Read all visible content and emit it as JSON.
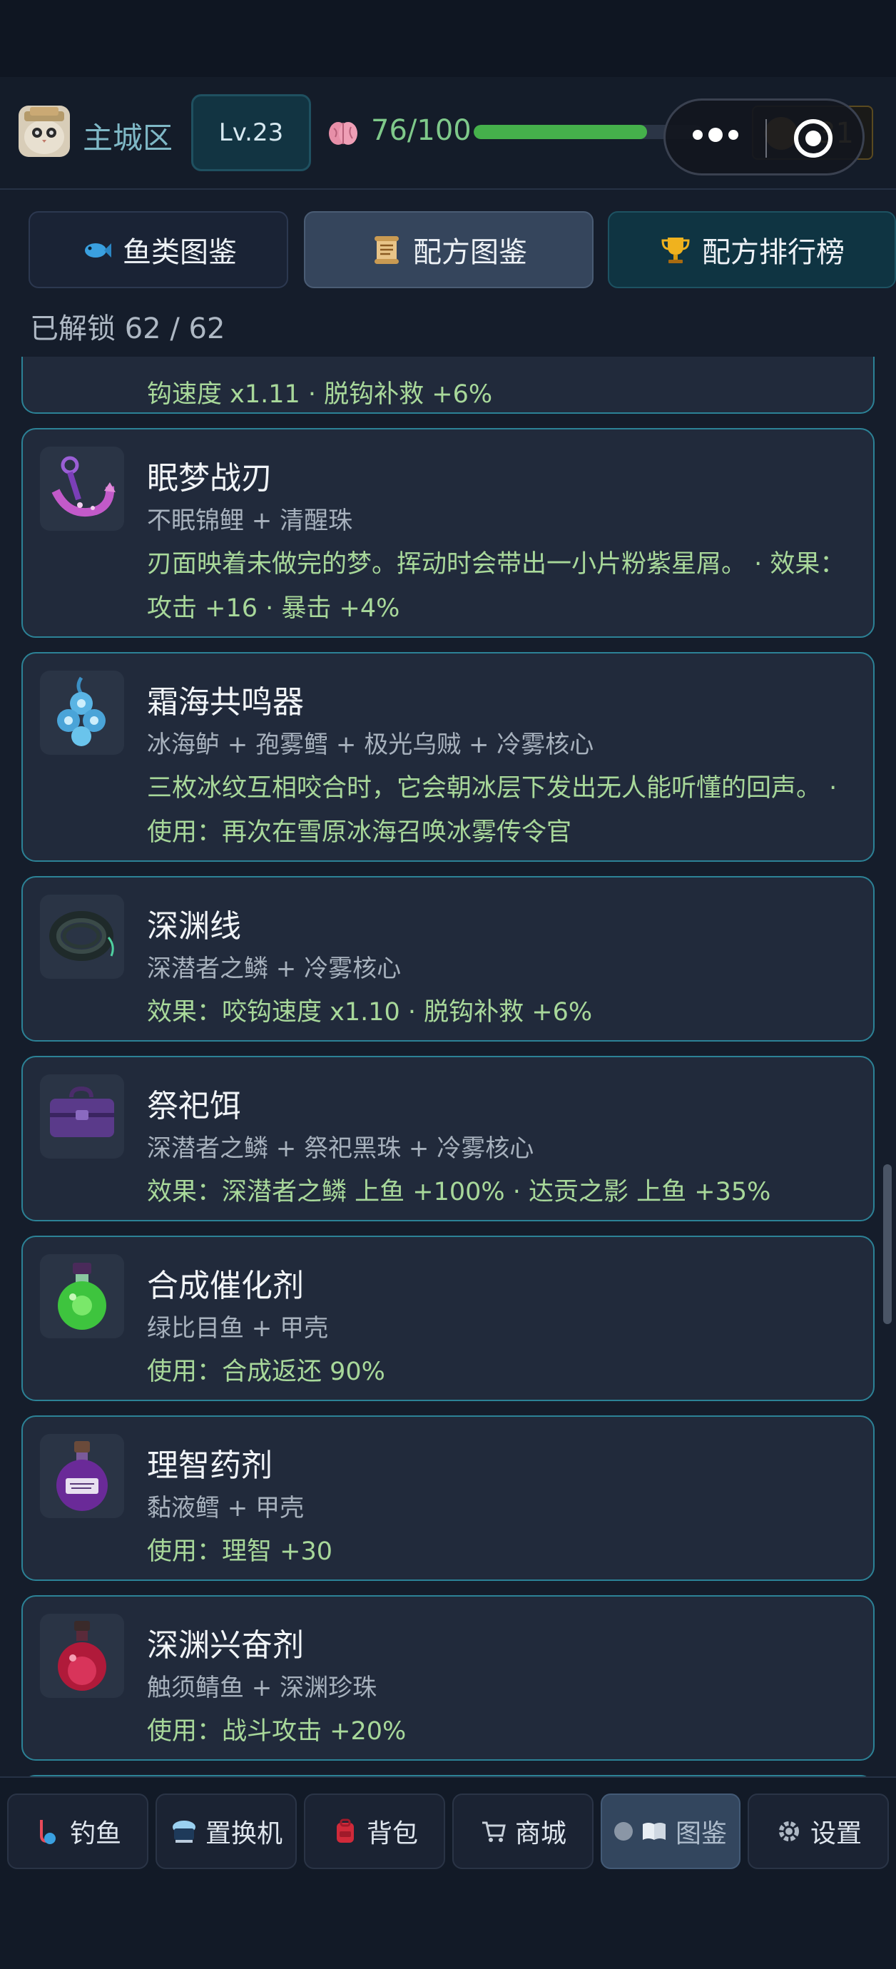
{
  "header": {
    "location": "主城区",
    "level": "Lv.23",
    "sanity_text": "76/100",
    "sanity_fraction": 0.76,
    "coins": "31"
  },
  "tabs": [
    {
      "label": "鱼类图鉴",
      "icon": "fish-icon"
    },
    {
      "label": "配方图鉴",
      "icon": "scroll-icon"
    },
    {
      "label": "配方排行榜",
      "icon": "trophy-icon"
    }
  ],
  "unlock_text": "已解锁 62 / 62",
  "recipes": [
    {
      "name": "",
      "ingredients": "",
      "effect": "钩速度 x1.11 · 脱钩补救 +6%"
    },
    {
      "name": "眠梦战刃",
      "ingredients": "不眠锦鲤 + 清醒珠",
      "effect": "刃面映着未做完的梦。挥动时会带出一小片粉紫星屑。 · 效果：攻击 +16 · 暴击 +4%",
      "icon": "anchor-blade-icon"
    },
    {
      "name": "霜海共鸣器",
      "ingredients": "冰海鲈 + 孢雾鳕 + 极光乌贼 + 冷雾核心",
      "effect": "三枚冰纹互相咬合时，它会朝冰层下发出无人能听懂的回声。 · 使用：再次在雪原冰海召唤冰雾传令官",
      "icon": "frost-resonator-icon"
    },
    {
      "name": "深渊线",
      "ingredients": "深潜者之鳞 + 冷雾核心",
      "effect": "效果：咬钩速度 x1.10 · 脱钩补救 +6%",
      "icon": "fishing-line-icon"
    },
    {
      "name": "祭祀饵",
      "ingredients": "深潜者之鳞 + 祭祀黑珠 + 冷雾核心",
      "effect": "效果：深潜者之鳞 上鱼 +100% · 达贡之影 上鱼 +35%",
      "icon": "tackle-box-icon"
    },
    {
      "name": "合成催化剂",
      "ingredients": "绿比目鱼 + 甲壳",
      "effect": "使用：合成返还 90%",
      "icon": "green-potion-icon"
    },
    {
      "name": "理智药剂",
      "ingredients": "黏液鳕 + 甲壳",
      "effect": "使用：理智 +30",
      "icon": "purple-potion-icon"
    },
    {
      "name": "深渊兴奋剂",
      "ingredients": "触须鲭鱼 + 深渊珍珠",
      "effect": "使用：战斗攻击 +20%",
      "icon": "red-potion-icon"
    }
  ],
  "bottom_nav": [
    {
      "label": "钓鱼",
      "icon": "fishing-icon"
    },
    {
      "label": "置换机",
      "icon": "machine-icon"
    },
    {
      "label": "背包",
      "icon": "backpack-icon"
    },
    {
      "label": "商城",
      "icon": "cart-icon"
    },
    {
      "label": "图鉴",
      "icon": "book-icon"
    },
    {
      "label": "设置",
      "icon": "gear-icon"
    }
  ],
  "colors": {
    "card_border": "#2c8296",
    "effect_text": "#a8d89a",
    "sanity_bar": "#45b04b"
  }
}
